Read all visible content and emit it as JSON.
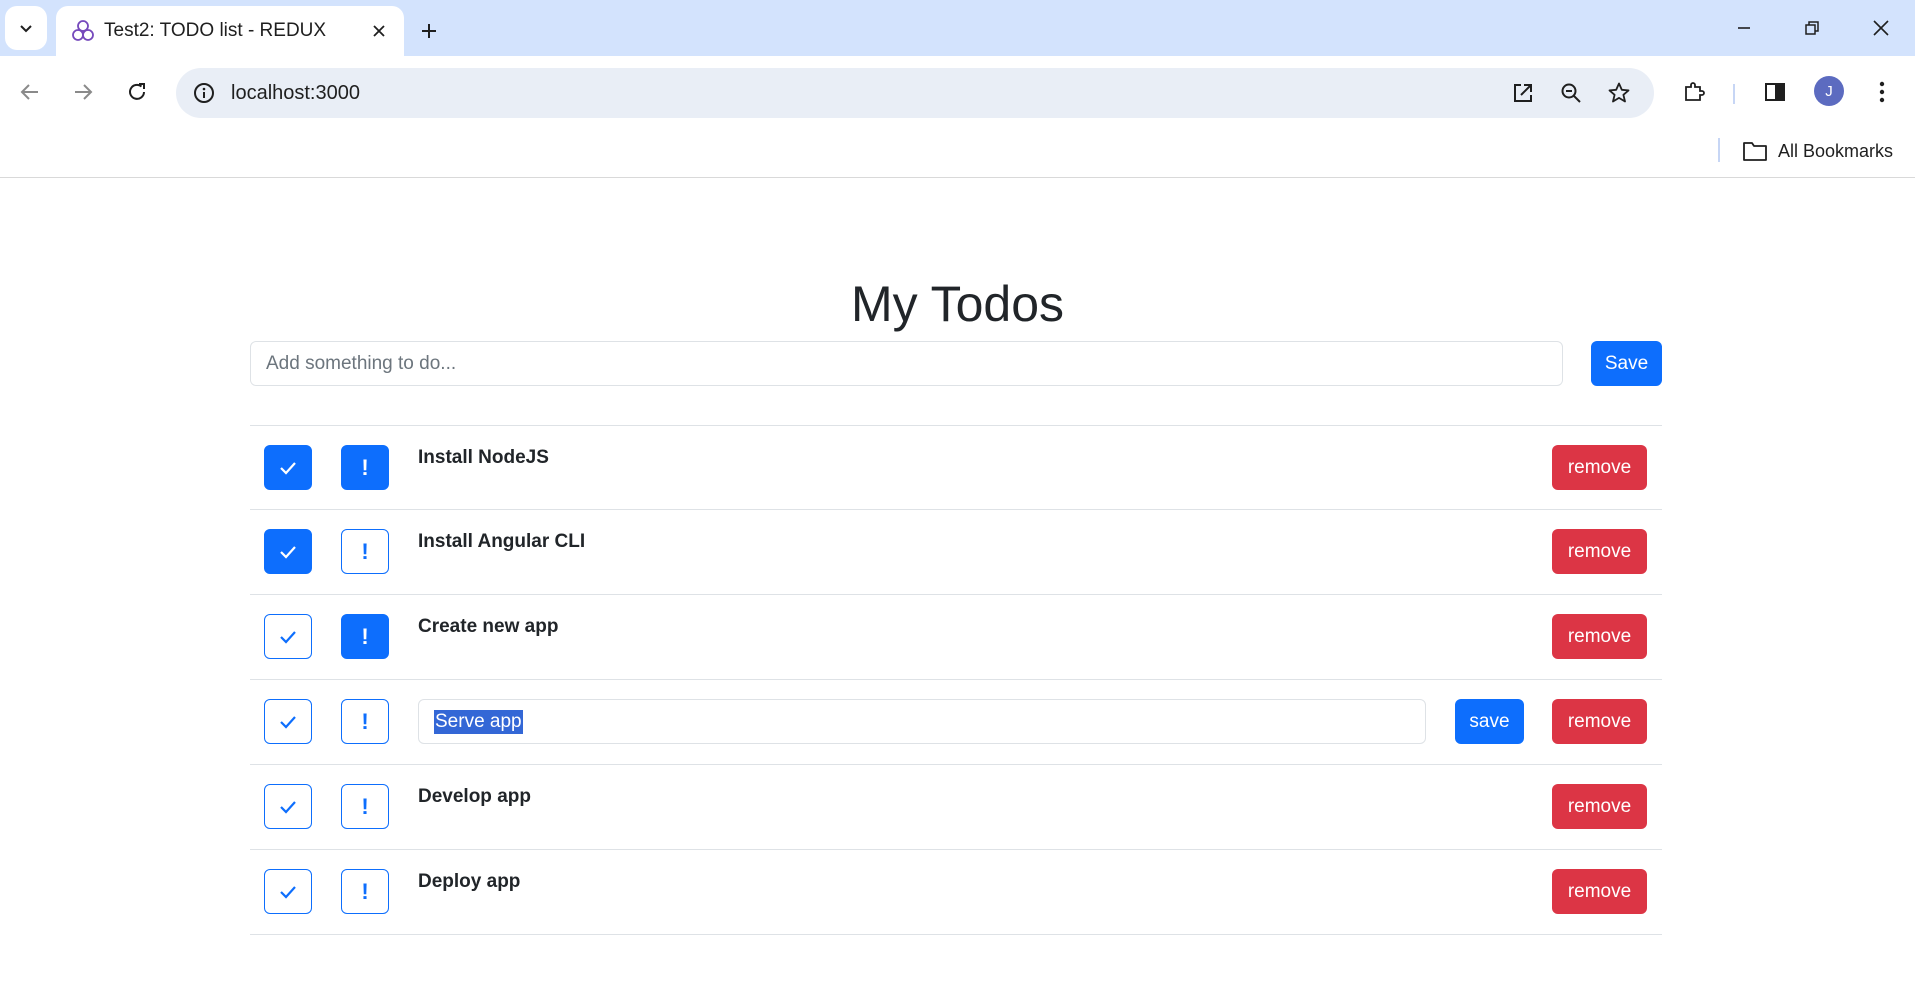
{
  "browser": {
    "tab_title": "Test2: TODO list - REDUX",
    "url": "localhost:3000",
    "bookmarks_label": "All Bookmarks",
    "profile_initial": "J"
  },
  "page": {
    "title": "My Todos",
    "add_placeholder": "Add something to do...",
    "add_save_label": "Save"
  },
  "todos": [
    {
      "text": "Install NodeJS",
      "done": true,
      "important": true,
      "editing": false,
      "remove_label": "remove"
    },
    {
      "text": "Install Angular CLI",
      "done": true,
      "important": false,
      "editing": false,
      "remove_label": "remove"
    },
    {
      "text": "Create new app",
      "done": false,
      "important": true,
      "editing": false,
      "remove_label": "remove"
    },
    {
      "text": "Serve app",
      "done": false,
      "important": false,
      "editing": true,
      "save_label": "save",
      "remove_label": "remove"
    },
    {
      "text": "Develop app",
      "done": false,
      "important": false,
      "editing": false,
      "remove_label": "remove"
    },
    {
      "text": "Deploy app",
      "done": false,
      "important": false,
      "editing": false,
      "remove_label": "remove"
    }
  ],
  "icons": {
    "done": "check-icon",
    "important": "exclamation-icon"
  },
  "colors": {
    "primary": "#0d6efd",
    "danger": "#dc3545",
    "tabstrip": "#d3e3fd"
  }
}
